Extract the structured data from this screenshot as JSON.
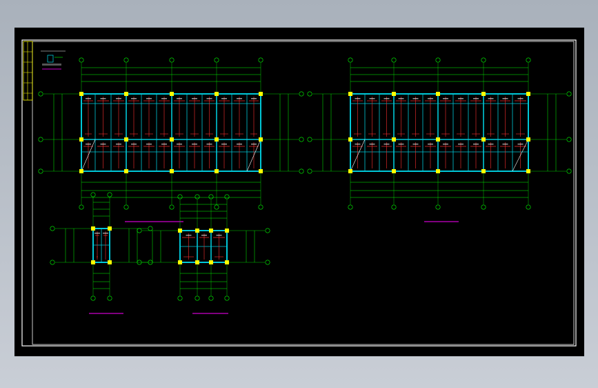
{
  "colors": {
    "background": "#000000",
    "frame": "#ffffff",
    "grid_axis": "#00ff00",
    "beam": "#00c8d8",
    "rebar": "#ff3030",
    "column": "#ffff00",
    "title_line": "#cc00cc"
  },
  "drawings": {
    "plan_left": {
      "title": "",
      "scale": ""
    },
    "plan_right": {
      "title": "",
      "scale": ""
    },
    "detail_small": {
      "title": "",
      "scale": ""
    },
    "detail_medium": {
      "title": "",
      "scale": ""
    }
  },
  "notes": {
    "heading": "",
    "lines": [
      "",
      "",
      "",
      ""
    ]
  },
  "title_block": {
    "drawing_name": "",
    "sheet_no": ""
  }
}
